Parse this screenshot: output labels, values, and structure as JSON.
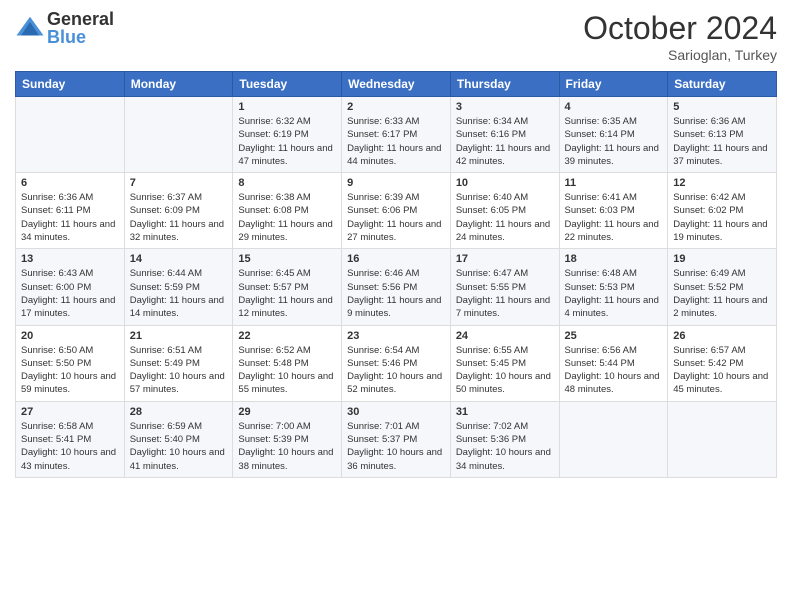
{
  "logo": {
    "general": "General",
    "blue": "Blue"
  },
  "title": "October 2024",
  "location": "Sarioglan, Turkey",
  "days_of_week": [
    "Sunday",
    "Monday",
    "Tuesday",
    "Wednesday",
    "Thursday",
    "Friday",
    "Saturday"
  ],
  "weeks": [
    [
      {
        "day": "",
        "sunrise": "",
        "sunset": "",
        "daylight": ""
      },
      {
        "day": "",
        "sunrise": "",
        "sunset": "",
        "daylight": ""
      },
      {
        "day": "1",
        "sunrise": "Sunrise: 6:32 AM",
        "sunset": "Sunset: 6:19 PM",
        "daylight": "Daylight: 11 hours and 47 minutes."
      },
      {
        "day": "2",
        "sunrise": "Sunrise: 6:33 AM",
        "sunset": "Sunset: 6:17 PM",
        "daylight": "Daylight: 11 hours and 44 minutes."
      },
      {
        "day": "3",
        "sunrise": "Sunrise: 6:34 AM",
        "sunset": "Sunset: 6:16 PM",
        "daylight": "Daylight: 11 hours and 42 minutes."
      },
      {
        "day": "4",
        "sunrise": "Sunrise: 6:35 AM",
        "sunset": "Sunset: 6:14 PM",
        "daylight": "Daylight: 11 hours and 39 minutes."
      },
      {
        "day": "5",
        "sunrise": "Sunrise: 6:36 AM",
        "sunset": "Sunset: 6:13 PM",
        "daylight": "Daylight: 11 hours and 37 minutes."
      }
    ],
    [
      {
        "day": "6",
        "sunrise": "Sunrise: 6:36 AM",
        "sunset": "Sunset: 6:11 PM",
        "daylight": "Daylight: 11 hours and 34 minutes."
      },
      {
        "day": "7",
        "sunrise": "Sunrise: 6:37 AM",
        "sunset": "Sunset: 6:09 PM",
        "daylight": "Daylight: 11 hours and 32 minutes."
      },
      {
        "day": "8",
        "sunrise": "Sunrise: 6:38 AM",
        "sunset": "Sunset: 6:08 PM",
        "daylight": "Daylight: 11 hours and 29 minutes."
      },
      {
        "day": "9",
        "sunrise": "Sunrise: 6:39 AM",
        "sunset": "Sunset: 6:06 PM",
        "daylight": "Daylight: 11 hours and 27 minutes."
      },
      {
        "day": "10",
        "sunrise": "Sunrise: 6:40 AM",
        "sunset": "Sunset: 6:05 PM",
        "daylight": "Daylight: 11 hours and 24 minutes."
      },
      {
        "day": "11",
        "sunrise": "Sunrise: 6:41 AM",
        "sunset": "Sunset: 6:03 PM",
        "daylight": "Daylight: 11 hours and 22 minutes."
      },
      {
        "day": "12",
        "sunrise": "Sunrise: 6:42 AM",
        "sunset": "Sunset: 6:02 PM",
        "daylight": "Daylight: 11 hours and 19 minutes."
      }
    ],
    [
      {
        "day": "13",
        "sunrise": "Sunrise: 6:43 AM",
        "sunset": "Sunset: 6:00 PM",
        "daylight": "Daylight: 11 hours and 17 minutes."
      },
      {
        "day": "14",
        "sunrise": "Sunrise: 6:44 AM",
        "sunset": "Sunset: 5:59 PM",
        "daylight": "Daylight: 11 hours and 14 minutes."
      },
      {
        "day": "15",
        "sunrise": "Sunrise: 6:45 AM",
        "sunset": "Sunset: 5:57 PM",
        "daylight": "Daylight: 11 hours and 12 minutes."
      },
      {
        "day": "16",
        "sunrise": "Sunrise: 6:46 AM",
        "sunset": "Sunset: 5:56 PM",
        "daylight": "Daylight: 11 hours and 9 minutes."
      },
      {
        "day": "17",
        "sunrise": "Sunrise: 6:47 AM",
        "sunset": "Sunset: 5:55 PM",
        "daylight": "Daylight: 11 hours and 7 minutes."
      },
      {
        "day": "18",
        "sunrise": "Sunrise: 6:48 AM",
        "sunset": "Sunset: 5:53 PM",
        "daylight": "Daylight: 11 hours and 4 minutes."
      },
      {
        "day": "19",
        "sunrise": "Sunrise: 6:49 AM",
        "sunset": "Sunset: 5:52 PM",
        "daylight": "Daylight: 11 hours and 2 minutes."
      }
    ],
    [
      {
        "day": "20",
        "sunrise": "Sunrise: 6:50 AM",
        "sunset": "Sunset: 5:50 PM",
        "daylight": "Daylight: 10 hours and 59 minutes."
      },
      {
        "day": "21",
        "sunrise": "Sunrise: 6:51 AM",
        "sunset": "Sunset: 5:49 PM",
        "daylight": "Daylight: 10 hours and 57 minutes."
      },
      {
        "day": "22",
        "sunrise": "Sunrise: 6:52 AM",
        "sunset": "Sunset: 5:48 PM",
        "daylight": "Daylight: 10 hours and 55 minutes."
      },
      {
        "day": "23",
        "sunrise": "Sunrise: 6:54 AM",
        "sunset": "Sunset: 5:46 PM",
        "daylight": "Daylight: 10 hours and 52 minutes."
      },
      {
        "day": "24",
        "sunrise": "Sunrise: 6:55 AM",
        "sunset": "Sunset: 5:45 PM",
        "daylight": "Daylight: 10 hours and 50 minutes."
      },
      {
        "day": "25",
        "sunrise": "Sunrise: 6:56 AM",
        "sunset": "Sunset: 5:44 PM",
        "daylight": "Daylight: 10 hours and 48 minutes."
      },
      {
        "day": "26",
        "sunrise": "Sunrise: 6:57 AM",
        "sunset": "Sunset: 5:42 PM",
        "daylight": "Daylight: 10 hours and 45 minutes."
      }
    ],
    [
      {
        "day": "27",
        "sunrise": "Sunrise: 6:58 AM",
        "sunset": "Sunset: 5:41 PM",
        "daylight": "Daylight: 10 hours and 43 minutes."
      },
      {
        "day": "28",
        "sunrise": "Sunrise: 6:59 AM",
        "sunset": "Sunset: 5:40 PM",
        "daylight": "Daylight: 10 hours and 41 minutes."
      },
      {
        "day": "29",
        "sunrise": "Sunrise: 7:00 AM",
        "sunset": "Sunset: 5:39 PM",
        "daylight": "Daylight: 10 hours and 38 minutes."
      },
      {
        "day": "30",
        "sunrise": "Sunrise: 7:01 AM",
        "sunset": "Sunset: 5:37 PM",
        "daylight": "Daylight: 10 hours and 36 minutes."
      },
      {
        "day": "31",
        "sunrise": "Sunrise: 7:02 AM",
        "sunset": "Sunset: 5:36 PM",
        "daylight": "Daylight: 10 hours and 34 minutes."
      },
      {
        "day": "",
        "sunrise": "",
        "sunset": "",
        "daylight": ""
      },
      {
        "day": "",
        "sunrise": "",
        "sunset": "",
        "daylight": ""
      }
    ]
  ]
}
